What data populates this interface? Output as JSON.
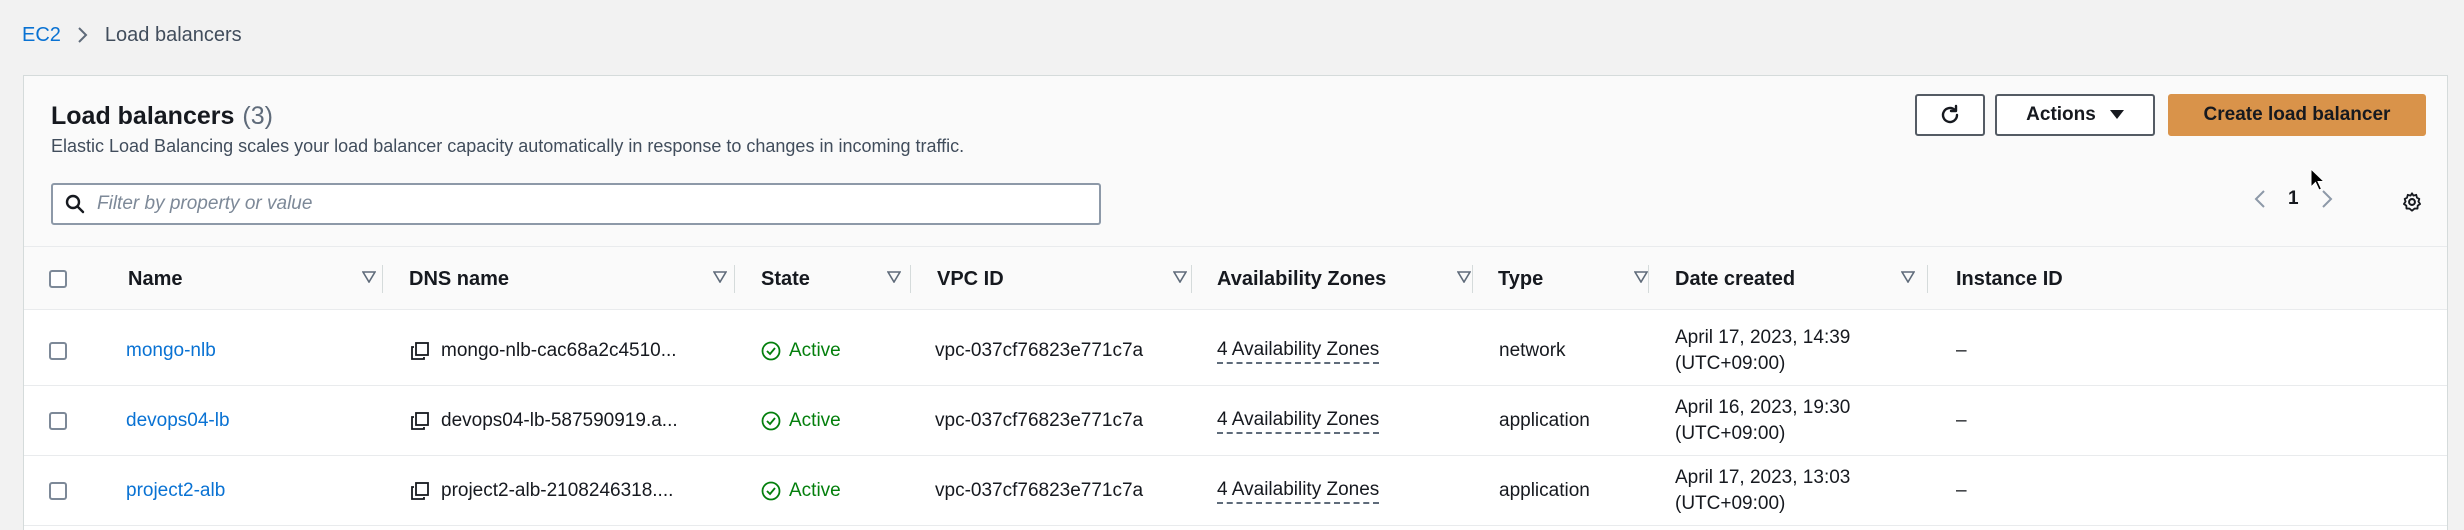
{
  "breadcrumb": {
    "root": "EC2",
    "current": "Load balancers"
  },
  "header": {
    "title": "Load balancers",
    "count": "(3)",
    "description": "Elastic Load Balancing scales your load balancer capacity automatically in response to changes in incoming traffic.",
    "actions_label": "Actions",
    "create_label": "Create load balancer"
  },
  "search": {
    "placeholder": "Filter by property or value",
    "value": ""
  },
  "pagination": {
    "page": "1"
  },
  "columns": {
    "name": "Name",
    "dns": "DNS name",
    "state": "State",
    "vpc": "VPC ID",
    "az": "Availability Zones",
    "type": "Type",
    "date": "Date created",
    "instance": "Instance ID"
  },
  "rows": [
    {
      "name": "mongo-nlb",
      "dns": "mongo-nlb-cac68a2c4510...",
      "state": "Active",
      "vpc": "vpc-037cf76823e771c7a",
      "az": "4 Availability Zones",
      "type": "network",
      "date_line1": "April 17, 2023, 14:39",
      "date_line2": "(UTC+09:00)",
      "instance": "–"
    },
    {
      "name": "devops04-lb",
      "dns": "devops04-lb-587590919.a...",
      "state": "Active",
      "vpc": "vpc-037cf76823e771c7a",
      "az": "4 Availability Zones",
      "type": "application",
      "date_line1": "April 16, 2023, 19:30",
      "date_line2": "(UTC+09:00)",
      "instance": "–"
    },
    {
      "name": "project2-alb",
      "dns": "project2-alb-2108246318....",
      "state": "Active",
      "vpc": "vpc-037cf76823e771c7a",
      "az": "4 Availability Zones",
      "type": "application",
      "date_line1": "April 17, 2023, 13:03",
      "date_line2": "(UTC+09:00)",
      "instance": "–"
    }
  ],
  "colors": {
    "link": "#0972d3",
    "primary_button": "#d9934a",
    "success": "#037f0c"
  }
}
